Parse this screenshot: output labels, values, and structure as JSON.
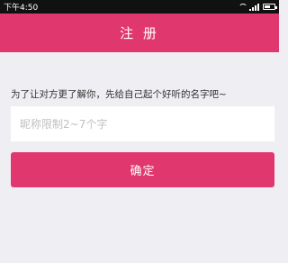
{
  "status_bar": {
    "time": "下午4:50",
    "battery_level": 0.6
  },
  "header": {
    "title": "注 册"
  },
  "form": {
    "hint": "为了让对方更了解你，先给自己起个好听的名字吧~",
    "nickname_value": "",
    "nickname_placeholder": "昵称限制2~7个字",
    "confirm_label": "确定"
  },
  "colors": {
    "accent": "#e0386e",
    "background": "#efeef2",
    "status_bar": "#111111"
  },
  "icons": {
    "wifi": "wifi-icon",
    "signal": "signal-icon",
    "battery": "battery-icon"
  }
}
